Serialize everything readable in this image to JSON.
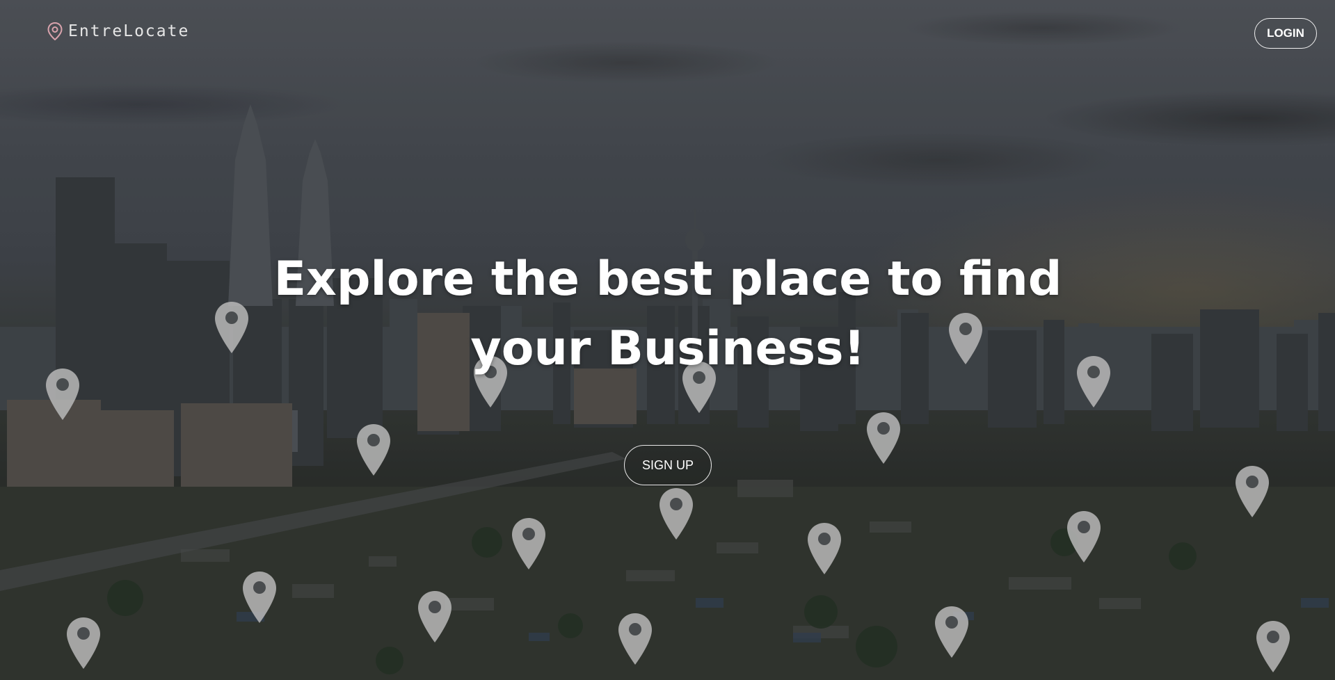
{
  "navbar": {
    "brand_icon": "map-pin-icon",
    "brand_name": "EntreLocate",
    "login_label": "LOGIN"
  },
  "hero": {
    "headline_line1": "Explore the best place to find",
    "headline_line2": "your Business!",
    "signup_label": "SIGN UP",
    "background_image": "city-skyline-with-map-pins",
    "pin_icon": "location-pin-icon"
  },
  "colors": {
    "text": "#ffffff",
    "brand_icon": "#d9a3ad",
    "button_border": "#f0f0f0",
    "pin": "#b9b9b9"
  }
}
